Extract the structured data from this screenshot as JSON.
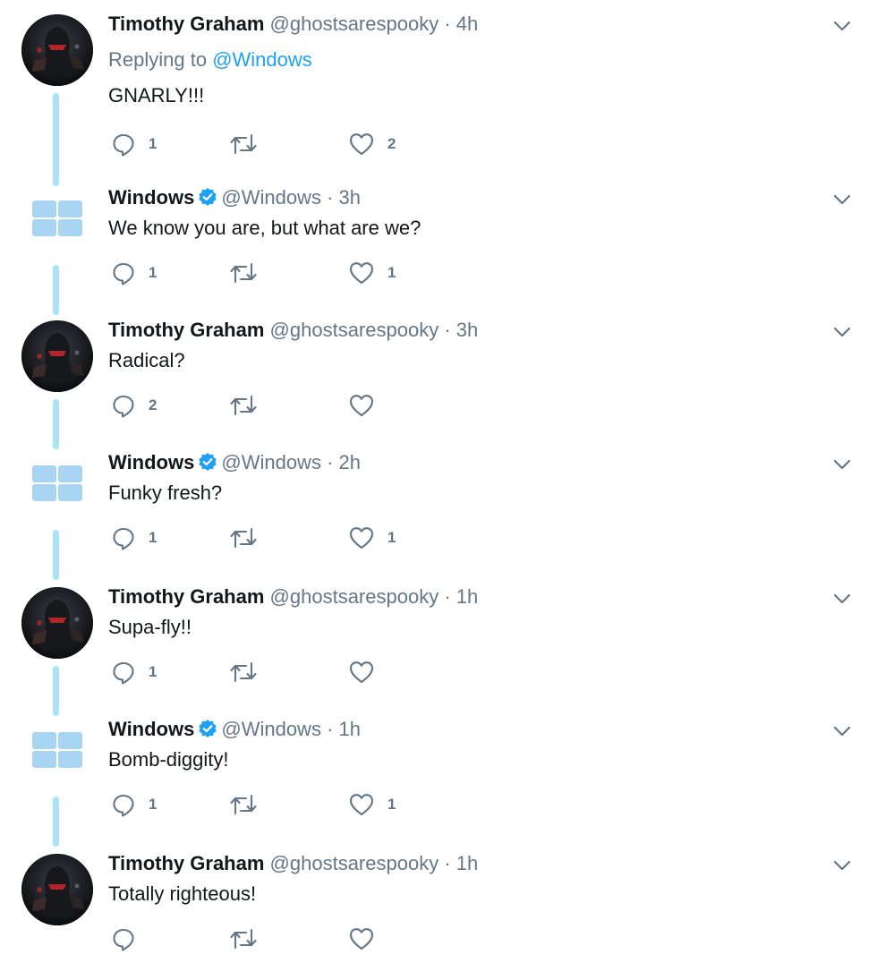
{
  "tweets": [
    {
      "author": "tim",
      "name": "Timothy Graham",
      "handle": "@ghostsarespooky",
      "time": "· 4h",
      "replying_label": "Replying to ",
      "replying_to": "@Windows",
      "text": "GNARLY!!!",
      "replies": "1",
      "retweets": "",
      "likes": "2"
    },
    {
      "author": "win",
      "name": "Windows",
      "handle": "@Windows",
      "time": "· 3h",
      "text": "We know you are, but what are we?",
      "replies": "1",
      "retweets": "",
      "likes": "1"
    },
    {
      "author": "tim",
      "name": "Timothy Graham",
      "handle": "@ghostsarespooky",
      "time": "· 3h",
      "text": "Radical?",
      "replies": "2",
      "retweets": "",
      "likes": ""
    },
    {
      "author": "win",
      "name": "Windows",
      "handle": "@Windows",
      "time": "· 2h",
      "text": "Funky fresh?",
      "replies": "1",
      "retweets": "",
      "likes": "1"
    },
    {
      "author": "tim",
      "name": "Timothy Graham",
      "handle": "@ghostsarespooky",
      "time": "· 1h",
      "text": "Supa-fly!!",
      "replies": "1",
      "retweets": "",
      "likes": ""
    },
    {
      "author": "win",
      "name": "Windows",
      "handle": "@Windows",
      "time": "· 1h",
      "text": "Bomb-diggity!",
      "replies": "1",
      "retweets": "",
      "likes": "1"
    },
    {
      "author": "tim",
      "name": "Timothy Graham",
      "handle": "@ghostsarespooky",
      "time": "· 1h",
      "text": "Totally righteous!",
      "replies": "",
      "retweets": "",
      "likes": ""
    }
  ],
  "icons": {
    "reply": "reply-icon",
    "retweet": "retweet-icon",
    "like": "heart-icon",
    "more": "chevron-down-icon",
    "verified": "verified-badge-icon"
  },
  "colors": {
    "link": "#1da1f2",
    "meta": "#657786",
    "thread_line": "#a8e4f6",
    "windows_logo": "#a8d5f2"
  }
}
